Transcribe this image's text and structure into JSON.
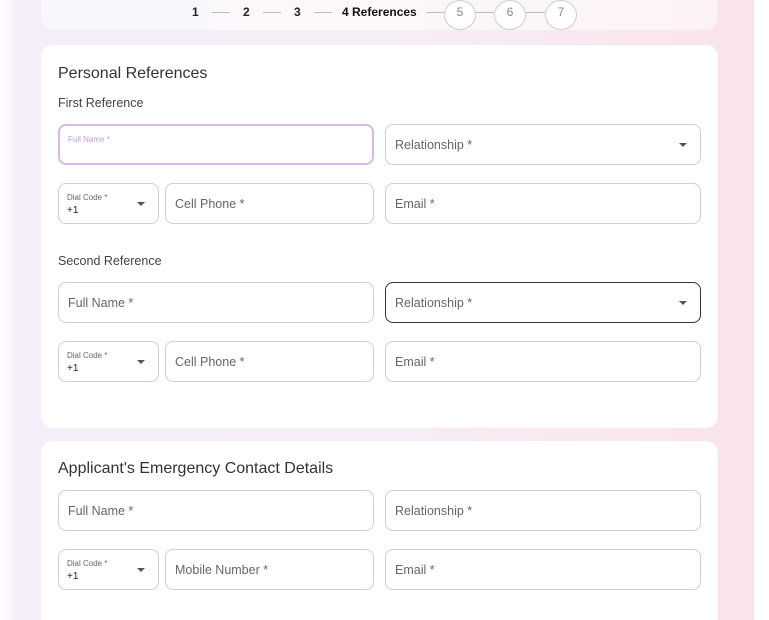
{
  "stepper": {
    "steps": [
      {
        "label": "1"
      },
      {
        "label": "2"
      },
      {
        "label": "3"
      },
      {
        "label": "4 References"
      },
      {
        "label": "5"
      },
      {
        "label": "6"
      },
      {
        "label": "7"
      }
    ]
  },
  "personal_references": {
    "title": "Personal References",
    "first": {
      "subtitle": "First Reference",
      "full_name_label": "Full Name *",
      "relationship": "Relationship *",
      "dial_code_label": "Dial Code *",
      "dial_code_value": "+1",
      "cell_phone": "Cell Phone *",
      "email": "Email *"
    },
    "second": {
      "subtitle": "Second Reference",
      "full_name": "Full Name *",
      "relationship": "Relationship *",
      "dial_code_label": "Dial Code *",
      "dial_code_value": "+1",
      "cell_phone": "Cell Phone *",
      "email": "Email *"
    }
  },
  "emergency_contact": {
    "title": "Applicant's Emergency Contact Details",
    "full_name": "Full Name *",
    "relationship": "Relationship *",
    "dial_code_label": "Dial Code *",
    "dial_code_value": "+1",
    "mobile_number": "Mobile Number *",
    "email": "Email *"
  },
  "icons": {
    "dropdown": "chevron-down-icon"
  }
}
